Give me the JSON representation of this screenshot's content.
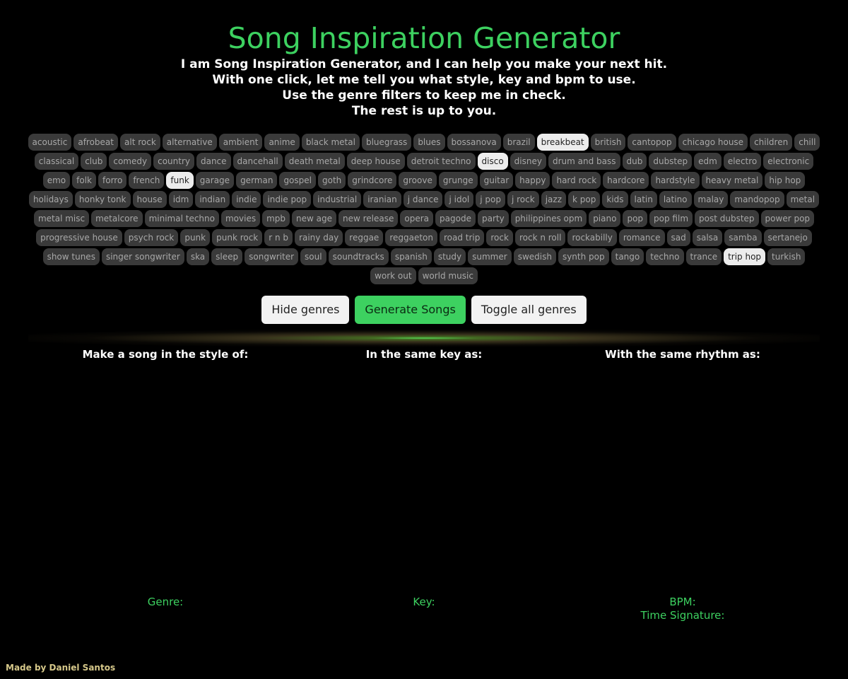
{
  "title": "Song Inspiration Generator",
  "intro": [
    "I am Song Inspiration Generator, and I can help you make your next hit.",
    "With one click, let me tell you what style, key and bpm to use.",
    "Use the genre filters to keep me in check.",
    "The rest is up to you."
  ],
  "genres": [
    {
      "label": "acoustic",
      "on": false
    },
    {
      "label": "afrobeat",
      "on": false
    },
    {
      "label": "alt rock",
      "on": false
    },
    {
      "label": "alternative",
      "on": false
    },
    {
      "label": "ambient",
      "on": false
    },
    {
      "label": "anime",
      "on": false
    },
    {
      "label": "black metal",
      "on": false
    },
    {
      "label": "bluegrass",
      "on": false
    },
    {
      "label": "blues",
      "on": false
    },
    {
      "label": "bossanova",
      "on": false
    },
    {
      "label": "brazil",
      "on": false
    },
    {
      "label": "breakbeat",
      "on": true
    },
    {
      "label": "british",
      "on": false
    },
    {
      "label": "cantopop",
      "on": false
    },
    {
      "label": "chicago house",
      "on": false
    },
    {
      "label": "children",
      "on": false
    },
    {
      "label": "chill",
      "on": false
    },
    {
      "label": "classical",
      "on": false
    },
    {
      "label": "club",
      "on": false
    },
    {
      "label": "comedy",
      "on": false
    },
    {
      "label": "country",
      "on": false
    },
    {
      "label": "dance",
      "on": false
    },
    {
      "label": "dancehall",
      "on": false
    },
    {
      "label": "death metal",
      "on": false
    },
    {
      "label": "deep house",
      "on": false
    },
    {
      "label": "detroit techno",
      "on": false
    },
    {
      "label": "disco",
      "on": true
    },
    {
      "label": "disney",
      "on": false
    },
    {
      "label": "drum and bass",
      "on": false
    },
    {
      "label": "dub",
      "on": false
    },
    {
      "label": "dubstep",
      "on": false
    },
    {
      "label": "edm",
      "on": false
    },
    {
      "label": "electro",
      "on": false
    },
    {
      "label": "electronic",
      "on": false
    },
    {
      "label": "emo",
      "on": false
    },
    {
      "label": "folk",
      "on": false
    },
    {
      "label": "forro",
      "on": false
    },
    {
      "label": "french",
      "on": false
    },
    {
      "label": "funk",
      "on": true
    },
    {
      "label": "garage",
      "on": false
    },
    {
      "label": "german",
      "on": false
    },
    {
      "label": "gospel",
      "on": false
    },
    {
      "label": "goth",
      "on": false
    },
    {
      "label": "grindcore",
      "on": false
    },
    {
      "label": "groove",
      "on": false
    },
    {
      "label": "grunge",
      "on": false
    },
    {
      "label": "guitar",
      "on": false
    },
    {
      "label": "happy",
      "on": false
    },
    {
      "label": "hard rock",
      "on": false
    },
    {
      "label": "hardcore",
      "on": false
    },
    {
      "label": "hardstyle",
      "on": false
    },
    {
      "label": "heavy metal",
      "on": false
    },
    {
      "label": "hip hop",
      "on": false
    },
    {
      "label": "holidays",
      "on": false
    },
    {
      "label": "honky tonk",
      "on": false
    },
    {
      "label": "house",
      "on": false
    },
    {
      "label": "idm",
      "on": false
    },
    {
      "label": "indian",
      "on": false
    },
    {
      "label": "indie",
      "on": false
    },
    {
      "label": "indie pop",
      "on": false
    },
    {
      "label": "industrial",
      "on": false
    },
    {
      "label": "iranian",
      "on": false
    },
    {
      "label": "j dance",
      "on": false
    },
    {
      "label": "j idol",
      "on": false
    },
    {
      "label": "j pop",
      "on": false
    },
    {
      "label": "j rock",
      "on": false
    },
    {
      "label": "jazz",
      "on": false
    },
    {
      "label": "k pop",
      "on": false
    },
    {
      "label": "kids",
      "on": false
    },
    {
      "label": "latin",
      "on": false
    },
    {
      "label": "latino",
      "on": false
    },
    {
      "label": "malay",
      "on": false
    },
    {
      "label": "mandopop",
      "on": false
    },
    {
      "label": "metal",
      "on": false
    },
    {
      "label": "metal misc",
      "on": false
    },
    {
      "label": "metalcore",
      "on": false
    },
    {
      "label": "minimal techno",
      "on": false
    },
    {
      "label": "movies",
      "on": false
    },
    {
      "label": "mpb",
      "on": false
    },
    {
      "label": "new age",
      "on": false
    },
    {
      "label": "new release",
      "on": false
    },
    {
      "label": "opera",
      "on": false
    },
    {
      "label": "pagode",
      "on": false
    },
    {
      "label": "party",
      "on": false
    },
    {
      "label": "philippines opm",
      "on": false
    },
    {
      "label": "piano",
      "on": false
    },
    {
      "label": "pop",
      "on": false
    },
    {
      "label": "pop film",
      "on": false
    },
    {
      "label": "post dubstep",
      "on": false
    },
    {
      "label": "power pop",
      "on": false
    },
    {
      "label": "progressive house",
      "on": false
    },
    {
      "label": "psych rock",
      "on": false
    },
    {
      "label": "punk",
      "on": false
    },
    {
      "label": "punk rock",
      "on": false
    },
    {
      "label": "r n b",
      "on": false
    },
    {
      "label": "rainy day",
      "on": false
    },
    {
      "label": "reggae",
      "on": false
    },
    {
      "label": "reggaeton",
      "on": false
    },
    {
      "label": "road trip",
      "on": false
    },
    {
      "label": "rock",
      "on": false
    },
    {
      "label": "rock n roll",
      "on": false
    },
    {
      "label": "rockabilly",
      "on": false
    },
    {
      "label": "romance",
      "on": false
    },
    {
      "label": "sad",
      "on": false
    },
    {
      "label": "salsa",
      "on": false
    },
    {
      "label": "samba",
      "on": false
    },
    {
      "label": "sertanejo",
      "on": false
    },
    {
      "label": "show tunes",
      "on": false
    },
    {
      "label": "singer songwriter",
      "on": false
    },
    {
      "label": "ska",
      "on": false
    },
    {
      "label": "sleep",
      "on": false
    },
    {
      "label": "songwriter",
      "on": false
    },
    {
      "label": "soul",
      "on": false
    },
    {
      "label": "soundtracks",
      "on": false
    },
    {
      "label": "spanish",
      "on": false
    },
    {
      "label": "study",
      "on": false
    },
    {
      "label": "summer",
      "on": false
    },
    {
      "label": "swedish",
      "on": false
    },
    {
      "label": "synth pop",
      "on": false
    },
    {
      "label": "tango",
      "on": false
    },
    {
      "label": "techno",
      "on": false
    },
    {
      "label": "trance",
      "on": false
    },
    {
      "label": "trip hop",
      "on": true
    },
    {
      "label": "turkish",
      "on": false
    },
    {
      "label": "work out",
      "on": false
    },
    {
      "label": "world music",
      "on": false
    }
  ],
  "buttons": {
    "hide": "Hide genres",
    "generate": "Generate Songs",
    "toggle": "Toggle all genres"
  },
  "columns": {
    "style_heading": "Make a song in the style of:",
    "key_heading": "In the same key as:",
    "rhythm_heading": "With the same rhythm as:",
    "genre_label": "Genre:",
    "key_label": "Key:",
    "bpm_label": "BPM:",
    "time_signature_label": "Time Signature:"
  },
  "credit": "Made by Daniel Santos",
  "colors": {
    "accent": "#3dd160",
    "chip_off": "#3a3a3a",
    "chip_on": "#ececec",
    "background": "#000000",
    "credit": "#d6c88a"
  }
}
